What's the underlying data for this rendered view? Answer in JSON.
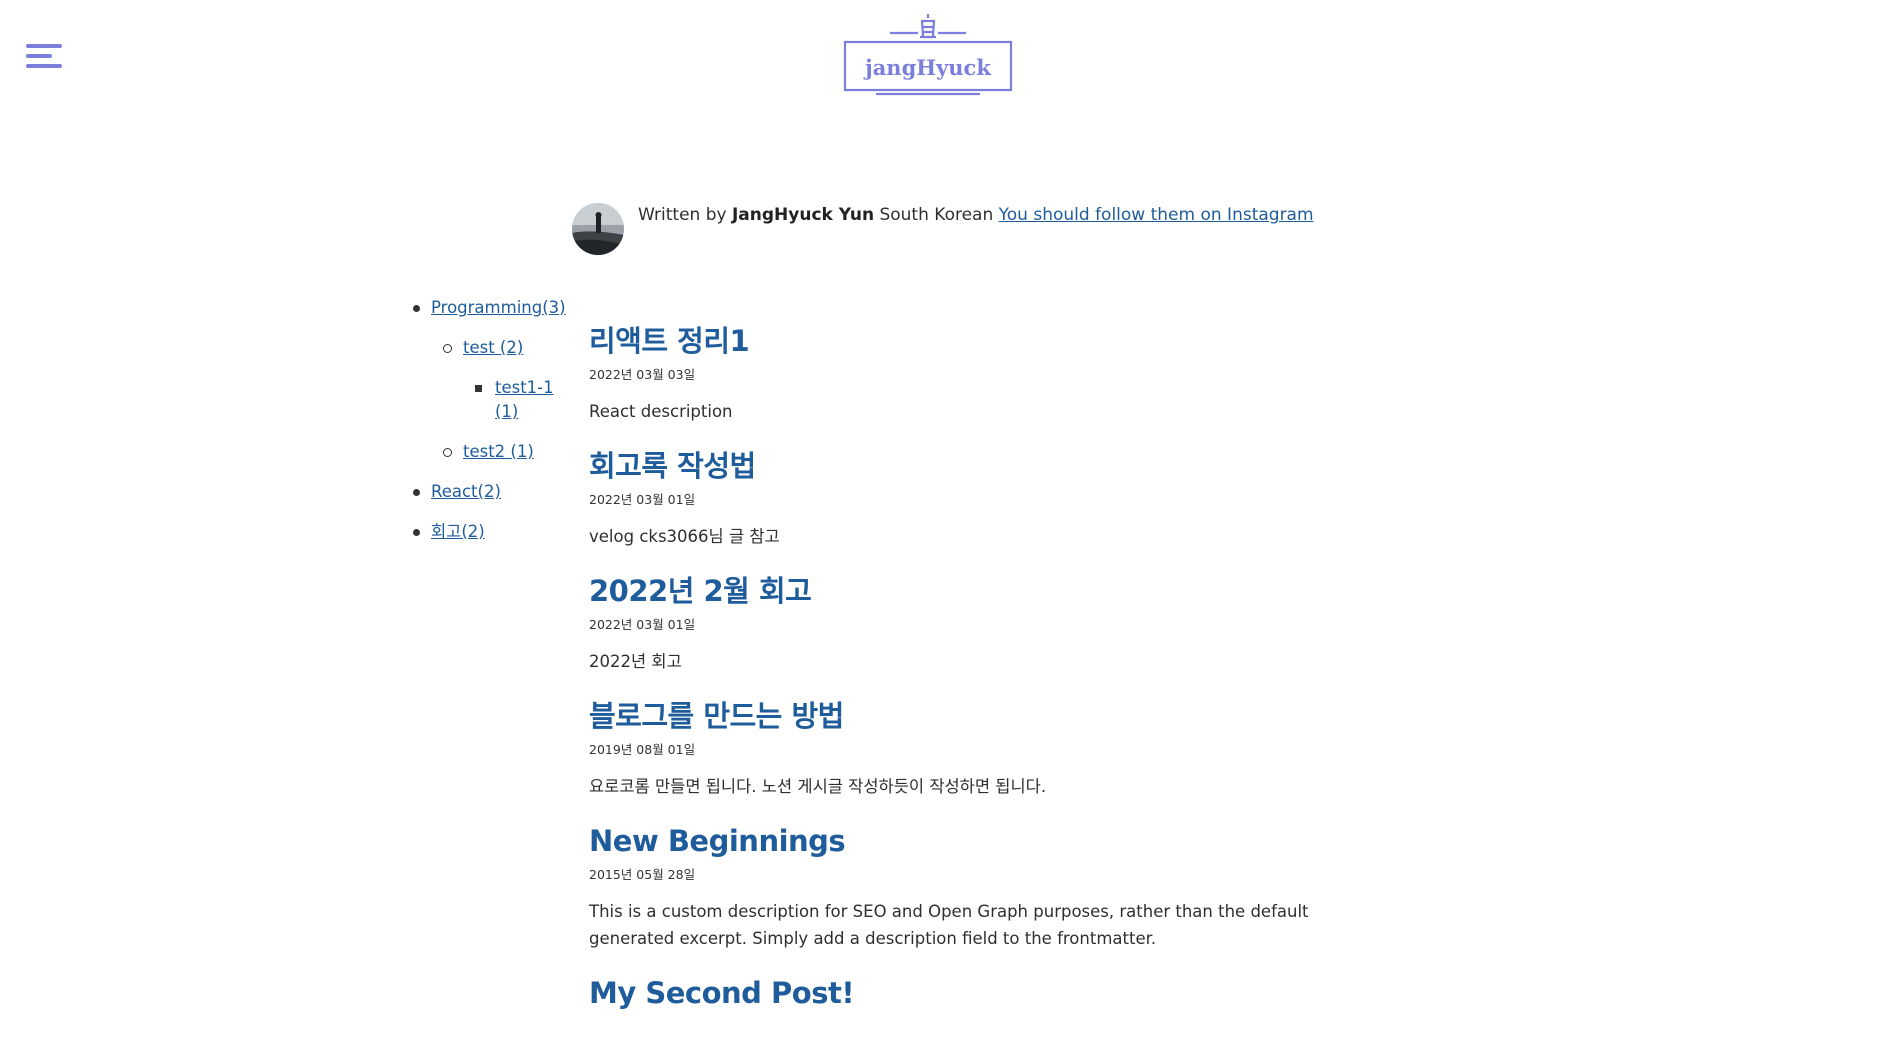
{
  "header": {
    "menu_icon": "hamburger-menu-icon",
    "logo_text": "jangHyuck",
    "logo_icon": "lighthouse-icon",
    "accent_color": "#7b7fdb"
  },
  "bio": {
    "written_by": "Written by",
    "author": "JangHyuck Yun",
    "summary": "South Korean",
    "follow_link": "You should follow them on Instagram"
  },
  "categories": {
    "programming": "Programming(3)",
    "test": "test (2)",
    "test1_1a": "test1-1",
    "test1_1b": "(1)",
    "test2": "test2 (1)",
    "react": "React(2)",
    "retro": "회고(2)"
  },
  "posts": [
    {
      "title": "리액트 정리1",
      "date": "2022년 03월 03일",
      "description": "React description"
    },
    {
      "title": "회고록 작성법",
      "date": "2022년 03월 01일",
      "description": "velog cks3066님 글 참고"
    },
    {
      "title": "2022년 2월 회고",
      "date": "2022년 03월 01일",
      "description": "2022년 회고"
    },
    {
      "title": "블로그를 만드는 방법",
      "date": "2019년 08월 01일",
      "description": "요로코롬 만들면 됩니다. 노션 게시글 작성하듯이 작성하면 됩니다."
    },
    {
      "title": "New Beginnings",
      "date": "2015년 05월 28일",
      "description": "This is a custom description for SEO and Open Graph purposes, rather than the default generated excerpt. Simply add a description field to the frontmatter."
    },
    {
      "title": "My Second Post!",
      "date": "",
      "description": ""
    }
  ]
}
